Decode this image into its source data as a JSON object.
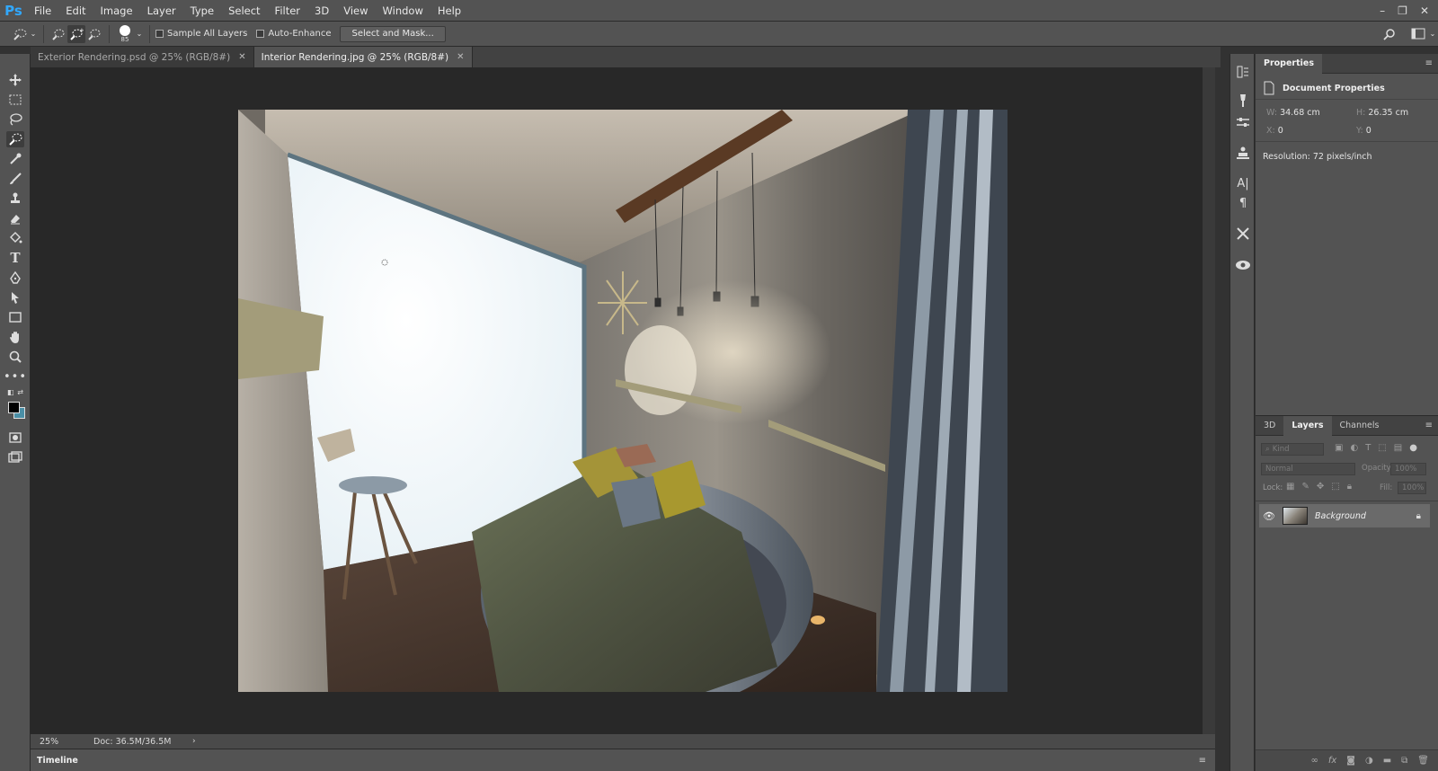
{
  "app": {
    "logo": "Ps"
  },
  "menu": [
    "File",
    "Edit",
    "Image",
    "Layer",
    "Type",
    "Select",
    "Filter",
    "3D",
    "View",
    "Window",
    "Help"
  ],
  "window_controls": {
    "minimize": "–",
    "restore": "❐",
    "close": "✕"
  },
  "options": {
    "brush_size": "85",
    "sample_all_layers": "Sample All Layers",
    "auto_enhance": "Auto-Enhance",
    "select_and_mask": "Select and Mask..."
  },
  "tabs": [
    {
      "label": "Exterior Rendering.psd @ 25% (RGB/8#)",
      "active": false
    },
    {
      "label": "Interior Rendering.jpg @ 25% (RGB/8#)",
      "active": true
    }
  ],
  "status": {
    "zoom": "25%",
    "doc": "Doc: 36.5M/36.5M"
  },
  "timeline": {
    "label": "Timeline"
  },
  "properties": {
    "title": "Properties",
    "section": "Document Properties",
    "w_label": "W:",
    "w_value": "34.68 cm",
    "h_label": "H:",
    "h_value": "26.35 cm",
    "x_label": "X:",
    "x_value": "0",
    "y_label": "Y:",
    "y_value": "0",
    "resolution": "Resolution: 72 pixels/inch"
  },
  "layers_panel": {
    "tabs": [
      "3D",
      "Layers",
      "Channels"
    ],
    "kind_placeholder": "Kind",
    "blend_mode": "Normal",
    "opacity_label": "Opacity:",
    "opacity_value": "100%",
    "lock_label": "Lock:",
    "fill_label": "Fill:",
    "fill_value": "100%",
    "layer_name": "Background"
  },
  "colors": {
    "accent": "#31a8ff",
    "chrome": "#535353",
    "canvas_bg": "#282828"
  }
}
